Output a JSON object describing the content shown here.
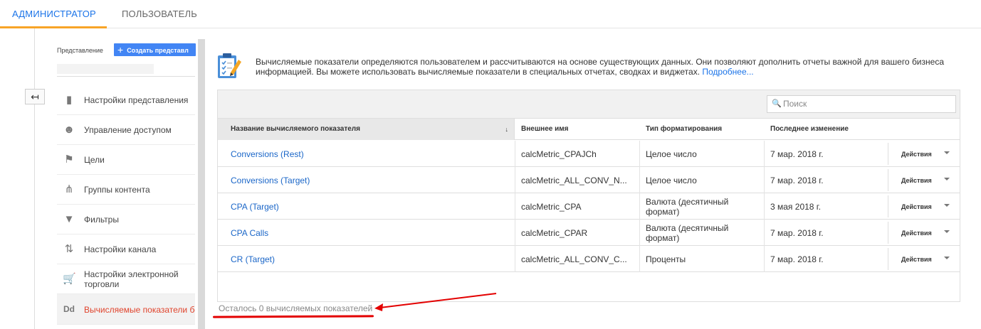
{
  "tabs": {
    "admin": "АДМИНИСТРАТОР",
    "user": "ПОЛЬЗОВАТЕЛЬ"
  },
  "sidebar": {
    "view_label": "Представление",
    "create_button": "Создать представл",
    "back_icon": "arrow-left-icon",
    "items": [
      {
        "label": "Настройки представления",
        "icon": "document-icon"
      },
      {
        "label": "Управление доступом",
        "icon": "people-icon"
      },
      {
        "label": "Цели",
        "icon": "flag-icon"
      },
      {
        "label": "Группы контента",
        "icon": "content-group-icon"
      },
      {
        "label": "Фильтры",
        "icon": "filter-icon"
      },
      {
        "label": "Настройки канала",
        "icon": "channel-icon"
      },
      {
        "label": "Настройки электронной торговли",
        "icon": "cart-icon"
      },
      {
        "label": "Вычисляемые показатели бе",
        "icon": "dd-icon",
        "icon_text": "Dd",
        "active": true
      }
    ]
  },
  "main": {
    "intro_text": "Вычисляемые показатели определяются пользователем и рассчитываются на основе существующих данных. Они позволяют дополнить отчеты важной для вашего бизнеса информацией. Вы можете использовать вычисляемые показатели в специальных отчетах, сводках и виджетах. ",
    "intro_link": "Подробнее...",
    "search_placeholder": "Поиск",
    "columns": {
      "name": "Название вычисляемого показателя",
      "external": "Внешнее имя",
      "format": "Тип форматирования",
      "modified": "Последнее изменение"
    },
    "rows": [
      {
        "name": "Conversions (Rest)",
        "external": "calcMetric_CPAJCh",
        "format": "Целое число",
        "modified": "7 мар. 2018 г.",
        "action": "Действия"
      },
      {
        "name": "Conversions (Target)",
        "external": "calcMetric_ALL_CONV_N...",
        "format": "Целое число",
        "modified": "7 мар. 2018 г.",
        "action": "Действия"
      },
      {
        "name": "CPA (Target)",
        "external": "calcMetric_CPA",
        "format": "Валюта (десятичный формат)",
        "modified": "3 мая 2018 г.",
        "action": "Действия"
      },
      {
        "name": "CPA Calls",
        "external": "calcMetric_CPAR",
        "format": "Валюта (десятичный формат)",
        "modified": "7 мар. 2018 г.",
        "action": "Действия"
      },
      {
        "name": "CR (Target)",
        "external": "calcMetric_ALL_CONV_C...",
        "format": "Проценты",
        "modified": "7 мар. 2018 г.",
        "action": "Действия"
      }
    ],
    "remaining": "Осталось 0 вычисляемых показателей"
  },
  "colors": {
    "accent": "#1a73e8",
    "tab_underline": "#f8a427",
    "annotation": "#e30000",
    "active_item": "#e0442d"
  }
}
